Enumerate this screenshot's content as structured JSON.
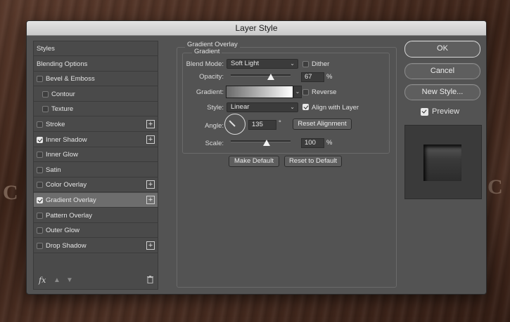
{
  "dialog": {
    "title": "Layer Style"
  },
  "sidebar": {
    "items": [
      {
        "label": "Styles",
        "checkbox": false,
        "checked": false,
        "plus": false,
        "indent": false,
        "selected": false
      },
      {
        "label": "Blending Options",
        "checkbox": false,
        "checked": false,
        "plus": false,
        "indent": false,
        "selected": false
      },
      {
        "label": "Bevel & Emboss",
        "checkbox": true,
        "checked": false,
        "plus": false,
        "indent": false,
        "selected": false
      },
      {
        "label": "Contour",
        "checkbox": true,
        "checked": false,
        "plus": false,
        "indent": true,
        "selected": false
      },
      {
        "label": "Texture",
        "checkbox": true,
        "checked": false,
        "plus": false,
        "indent": true,
        "selected": false
      },
      {
        "label": "Stroke",
        "checkbox": true,
        "checked": false,
        "plus": true,
        "indent": false,
        "selected": false
      },
      {
        "label": "Inner Shadow",
        "checkbox": true,
        "checked": true,
        "plus": true,
        "indent": false,
        "selected": false
      },
      {
        "label": "Inner Glow",
        "checkbox": true,
        "checked": false,
        "plus": false,
        "indent": false,
        "selected": false
      },
      {
        "label": "Satin",
        "checkbox": true,
        "checked": false,
        "plus": false,
        "indent": false,
        "selected": false
      },
      {
        "label": "Color Overlay",
        "checkbox": true,
        "checked": false,
        "plus": true,
        "indent": false,
        "selected": false
      },
      {
        "label": "Gradient Overlay",
        "checkbox": true,
        "checked": true,
        "plus": true,
        "indent": false,
        "selected": true
      },
      {
        "label": "Pattern Overlay",
        "checkbox": true,
        "checked": false,
        "plus": false,
        "indent": false,
        "selected": false
      },
      {
        "label": "Outer Glow",
        "checkbox": true,
        "checked": false,
        "plus": false,
        "indent": false,
        "selected": false
      },
      {
        "label": "Drop Shadow",
        "checkbox": true,
        "checked": false,
        "plus": true,
        "indent": false,
        "selected": false
      }
    ],
    "footer": {
      "fx": "fx",
      "up_icon": "arrow-up-icon",
      "down_icon": "arrow-down-icon",
      "trash_icon": "trash-icon"
    }
  },
  "panel": {
    "section_title": "Gradient Overlay",
    "group_title": "Gradient",
    "blend_mode": {
      "label": "Blend Mode:",
      "value": "Soft Light"
    },
    "dither": {
      "label": "Dither",
      "checked": false
    },
    "opacity": {
      "label": "Opacity:",
      "value": "67",
      "unit": "%",
      "level": 0.67
    },
    "gradient": {
      "label": "Gradient:",
      "from": "#6a6a6a",
      "to": "#ffffff"
    },
    "reverse": {
      "label": "Reverse",
      "checked": false
    },
    "style": {
      "label": "Style:",
      "value": "Linear"
    },
    "align": {
      "label": "Align with Layer",
      "checked": true
    },
    "angle": {
      "label": "Angle:",
      "value": "135",
      "unit": "°"
    },
    "reset_alignment": "Reset Alignment",
    "scale": {
      "label": "Scale:",
      "value": "100",
      "unit": "%",
      "level": 0.6
    },
    "make_default": "Make Default",
    "reset_default": "Reset to Default"
  },
  "actions": {
    "ok": "OK",
    "cancel": "Cancel",
    "new_style": "New Style...",
    "preview": {
      "label": "Preview",
      "checked": true
    }
  },
  "background_text": [
    "C",
    "C"
  ]
}
